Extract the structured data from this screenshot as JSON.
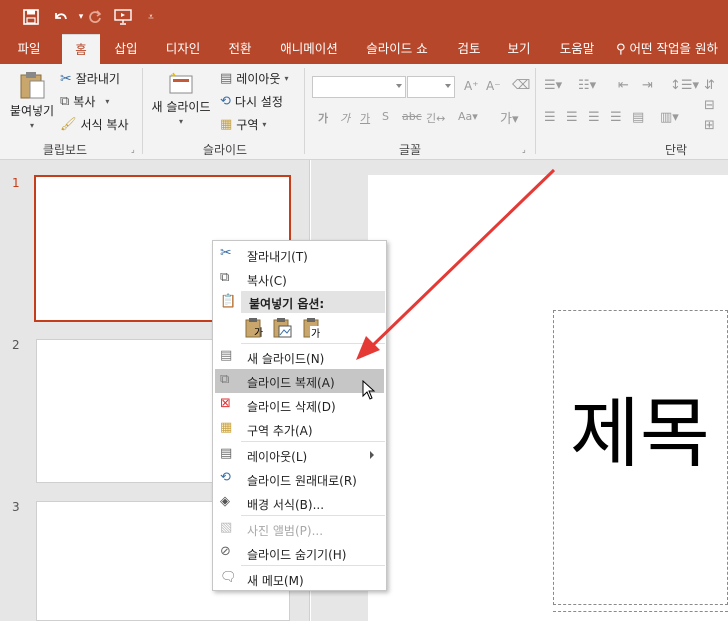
{
  "qat": {
    "save": "save",
    "undo": "undo",
    "redo": "redo",
    "present": "present"
  },
  "tabs": [
    "파일",
    "홈",
    "삽입",
    "디자인",
    "전환",
    "애니메이션",
    "슬라이드 쇼",
    "검토",
    "보기",
    "도움말"
  ],
  "tell_me": "어떤 작업을 원하",
  "ribbon": {
    "clipboard": {
      "paste": "붙여넣기",
      "cut": "잘라내기",
      "copy": "복사",
      "format_painter": "서식 복사",
      "label": "클립보드"
    },
    "slides": {
      "new_slide": "새 슬라이드",
      "layout": "레이아웃",
      "reset": "다시 설정",
      "section": "구역",
      "label": "슬라이드"
    },
    "font": {
      "label": "글꼴"
    },
    "paragraph": {
      "label": "단락"
    }
  },
  "thumbnails": [
    "1",
    "2",
    "3"
  ],
  "slide": {
    "title_text": "제목"
  },
  "context_menu": {
    "cut": "잘라내기(T)",
    "copy": "복사(C)",
    "paste_options": "붙여넣기 옵션:",
    "new_slide": "새 슬라이드(N)",
    "duplicate": "슬라이드 복제(A)",
    "delete": "슬라이드 삭제(D)",
    "add_section": "구역 추가(A)",
    "layout": "레이아웃(L)",
    "reset_slide": "슬라이드 원래대로(R)",
    "format_bg": "배경 서식(B)...",
    "photo_album": "사진 앨범(P)...",
    "hide_slide": "슬라이드 숨기기(H)",
    "new_comment": "새 메모(M)"
  },
  "colors": {
    "accent": "#b7472a",
    "selection": "#c43e1c",
    "annotation_arrow": "#e53935"
  }
}
